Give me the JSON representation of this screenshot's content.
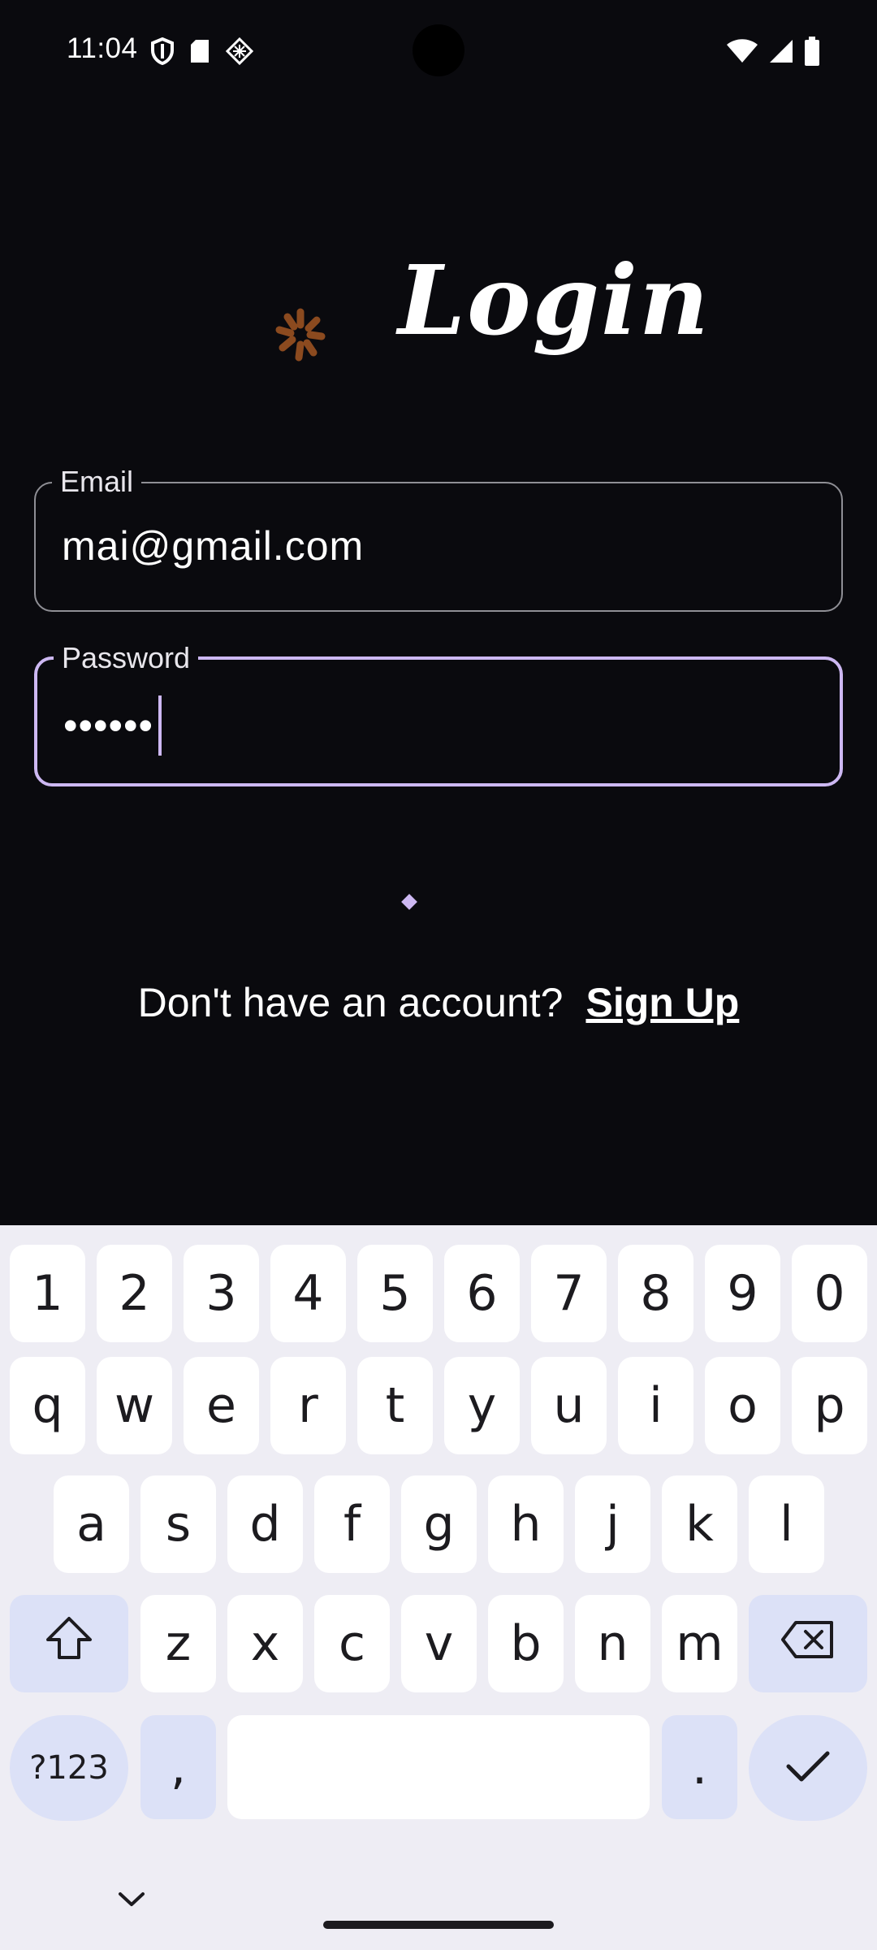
{
  "status_bar": {
    "time": "11:04",
    "left_icons": [
      "shield-icon",
      "sd-card-icon",
      "app-icon"
    ],
    "right_icons": [
      "wifi-icon",
      "signal-icon",
      "battery-icon"
    ]
  },
  "title": "Login",
  "email_field": {
    "label": "Email",
    "value": "mai@gmail.com"
  },
  "password_field": {
    "label": "Password",
    "value": "••••••"
  },
  "signup": {
    "prompt": "Don't have an account?",
    "link": "Sign Up"
  },
  "keyboard": {
    "number_row": [
      "1",
      "2",
      "3",
      "4",
      "5",
      "6",
      "7",
      "8",
      "9",
      "0"
    ],
    "row1": [
      "q",
      "w",
      "e",
      "r",
      "t",
      "y",
      "u",
      "i",
      "o",
      "p"
    ],
    "row2": [
      "a",
      "s",
      "d",
      "f",
      "g",
      "h",
      "j",
      "k",
      "l"
    ],
    "row3": [
      "z",
      "x",
      "c",
      "v",
      "b",
      "n",
      "m"
    ],
    "symbols_key": "?123",
    "comma_key": ",",
    "period_key": "."
  },
  "colors": {
    "background": "#0a0a0e",
    "accent": "#cdb8f2",
    "spinner": "#8b4a1f",
    "keyboard_bg": "#eeedf4",
    "function_key": "#dce1f7"
  }
}
